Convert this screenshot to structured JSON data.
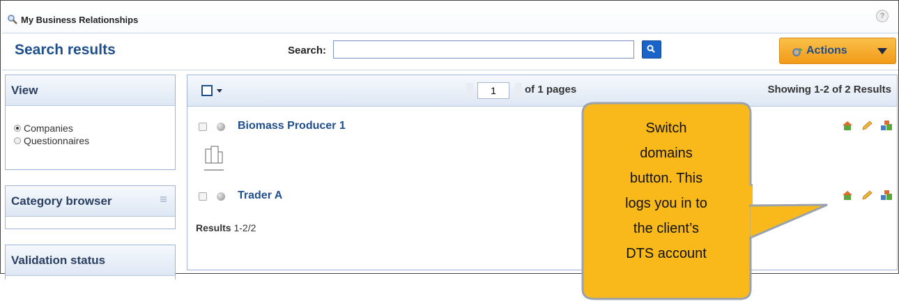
{
  "window": {
    "title": "My Business Relationships",
    "help_label": "?"
  },
  "header": {
    "page_title": "Search results",
    "search_label": "Search:",
    "search_value": "",
    "actions_label": "Actions"
  },
  "sidebar": {
    "view": {
      "title": "View",
      "options": [
        {
          "label": "Companies",
          "selected": true
        },
        {
          "label": "Questionnaires",
          "selected": false
        }
      ]
    },
    "category_browser": {
      "title": "Category browser"
    },
    "validation_status": {
      "title": "Validation status"
    }
  },
  "results": {
    "page": "1",
    "of_pages": "of 1 pages",
    "showing": "Showing 1-2 of 2 Results",
    "items": [
      {
        "name": "Biomass Producer 1",
        "has_logo": true
      },
      {
        "name": "Trader A",
        "has_logo": false
      }
    ],
    "footer_label": "Results",
    "footer_range": "1-2/2"
  },
  "callout": {
    "lines": [
      "Switch",
      "domains",
      "button. This",
      "logs you in to",
      "the client’s",
      "DTS account"
    ],
    "color": "#f9b91a"
  },
  "colors": {
    "accent_blue": "#1f4e8c",
    "actions_orange": "#f5a623",
    "search_button": "#1a63c9"
  }
}
